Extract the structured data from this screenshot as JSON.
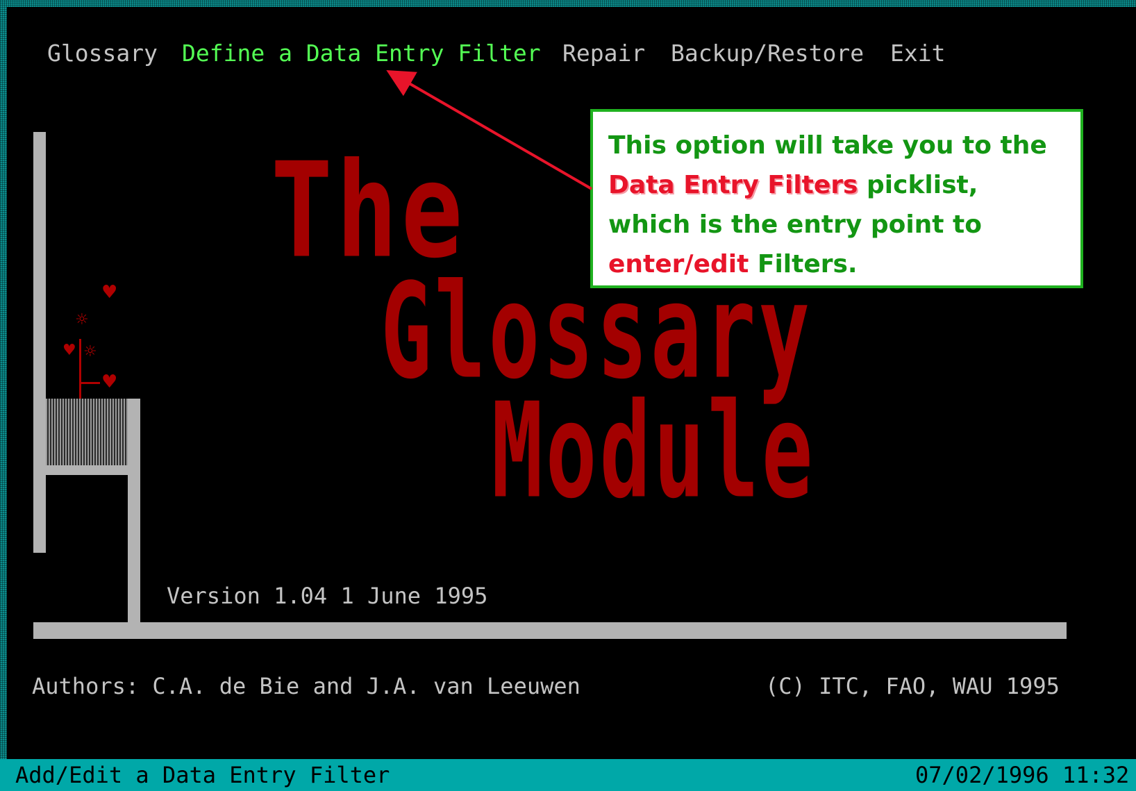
{
  "menu": {
    "items": [
      {
        "label": "Glossary"
      },
      {
        "label": "Define a Data Entry Filter"
      },
      {
        "label": "Repair"
      },
      {
        "label": "Backup/Restore"
      },
      {
        "label": "Exit"
      }
    ],
    "active_index": 1
  },
  "splash": {
    "title_line1": "The",
    "title_line2": "Glossary",
    "title_line3": "Module",
    "version": "Version 1.04 1 June 1995",
    "authors": "Authors: C.A. de Bie and J.A. van Leeuwen",
    "copyright": "(C) ITC, FAO, WAU 1995"
  },
  "callout": {
    "seg1": "This option will take you to the ",
    "seg2": "Data Entry Filters",
    "seg3": " picklist, which is the entry point to ",
    "seg4": "enter/edit",
    "seg5": " Filters."
  },
  "status_bar": {
    "message": "Add/Edit a Data Entry Filter",
    "datetime": "07/02/1996 11:32"
  },
  "colors": {
    "menu_text": "#c4c4c4",
    "menu_active": "#54ff54",
    "title_red": "#a30000",
    "callout_green": "#139613",
    "callout_red": "#e8142a",
    "status_bar_bg": "#00a8a8"
  }
}
